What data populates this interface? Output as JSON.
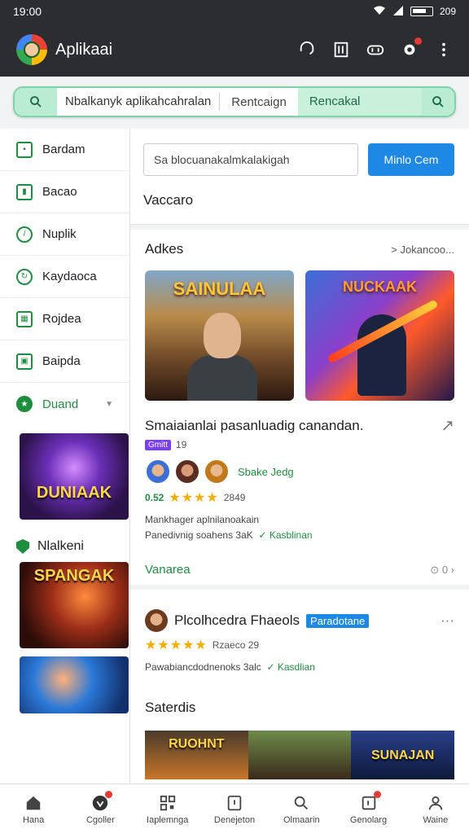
{
  "status": {
    "time": "19:00",
    "battery": "209"
  },
  "appbar": {
    "title": "Aplikaai"
  },
  "search": {
    "query": "Nbalkanyk aplikahcahralan",
    "chip1": "Rentcaign",
    "chip2": "Rencakal"
  },
  "sidebar": {
    "items": [
      {
        "label": "Bardam",
        "icon": "square-icon"
      },
      {
        "label": "Bacao",
        "icon": "chart-icon"
      },
      {
        "label": "Nuplik",
        "icon": "gauge-icon"
      },
      {
        "label": "Kaydaoca",
        "icon": "refresh-icon"
      },
      {
        "label": "Rojdea",
        "icon": "grid-icon"
      },
      {
        "label": "Baipda",
        "icon": "image-icon"
      }
    ],
    "expand_label": "Duand",
    "thumb1_title": "DUNIAAK",
    "section_label": "Nlalkeni",
    "thumb2_title": "SPANGAK"
  },
  "filter": {
    "input_placeholder": "Sa blocuanakalmkalakigah",
    "button": "Minlo Cem",
    "label": "Vaccaro"
  },
  "card1": {
    "header": "Adkes",
    "more": "> Jokancoo...",
    "img1_title": "SAINULAA",
    "img2_title": "NUCKAAK",
    "title": "Smaiaianlai pasanluadig canandan.",
    "badge": "Gmitt",
    "badge_count": "19",
    "avatar_label": "Sbake Jedg",
    "rating_value": "0.52",
    "rating_count": "2849",
    "desc_line1": "Mankhager aplnilanoakain",
    "desc_line2": "Panedivnig soahens 3aK",
    "verified": "Kasblinan",
    "footer": "Vanarea",
    "footer_count": "0"
  },
  "card2": {
    "publisher": "Plcolhcedra Fhaeols",
    "badge": "Paradotane",
    "rating_count": "Rzaeco 29",
    "desc": "Pawabiancdodnenoks 3alc",
    "verified": "Kasdlian",
    "section": "Saterdis",
    "strip_title": "RUOHNT",
    "strip_title2": "SUNAJAN"
  },
  "bottomnav": [
    {
      "label": "Hana",
      "icon": "home-icon"
    },
    {
      "label": "Cgoller",
      "icon": "heart-icon"
    },
    {
      "label": "Iaplemnga",
      "icon": "qr-icon"
    },
    {
      "label": "Denejeton",
      "icon": "bookmark-icon"
    },
    {
      "label": "Olmaarin",
      "icon": "search-icon"
    },
    {
      "label": "Genolarg",
      "icon": "inbox-icon"
    },
    {
      "label": "Waine",
      "icon": "user-icon"
    }
  ],
  "colors": {
    "accent": "#1e88e5",
    "green": "#1e8e3e",
    "appbar": "#2b2d31",
    "star": "#f9ab00"
  }
}
